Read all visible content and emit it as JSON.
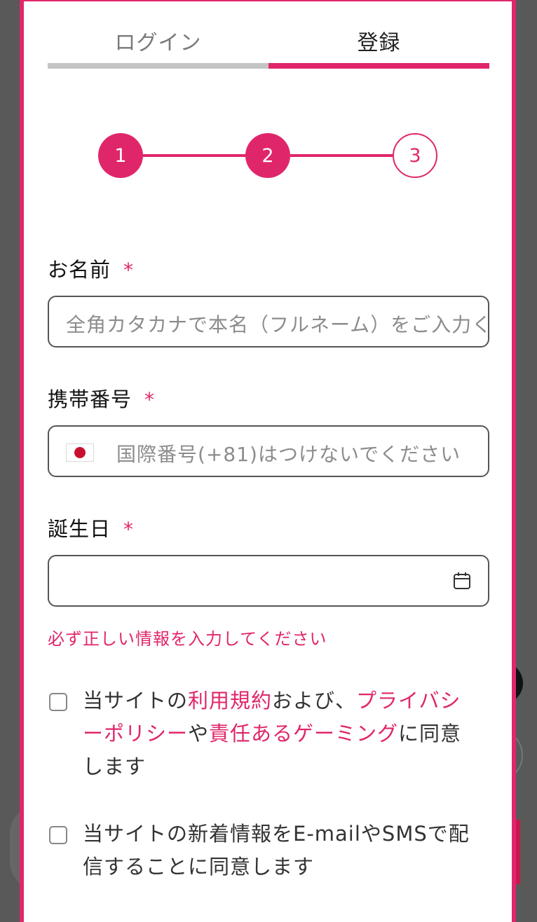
{
  "tabs": {
    "login": "ログイン",
    "register": "登録"
  },
  "stepper": {
    "steps": [
      "1",
      "2",
      "3"
    ],
    "current": 2
  },
  "form": {
    "required_mark": "*",
    "name": {
      "label": "お名前",
      "placeholder": "全角カタカナで本名（フルネーム）をご入力ください"
    },
    "phone": {
      "label": "携帯番号",
      "flag": "japan-flag-icon",
      "placeholder": "国際番号(+81)はつけないでください"
    },
    "birthday": {
      "label": "誕生日",
      "icon": "calendar-icon"
    },
    "error_message": "必ず正しい情報を入力してください"
  },
  "consent": {
    "terms": {
      "t1": "当サイトの",
      "link_terms": "利用規約",
      "t2": "および、",
      "link_privacy": "プライバシーポリシー",
      "t3": "や",
      "link_responsible": "責任あるゲーミング",
      "t4": "に同意します"
    },
    "newsletter": {
      "text": "当サイトの新着情報をE-mailやSMSで配信することに同意します"
    }
  },
  "colors": {
    "accent": "#e0266b",
    "tab_inactive": "#c4c4c4",
    "overlay": "#595959"
  }
}
